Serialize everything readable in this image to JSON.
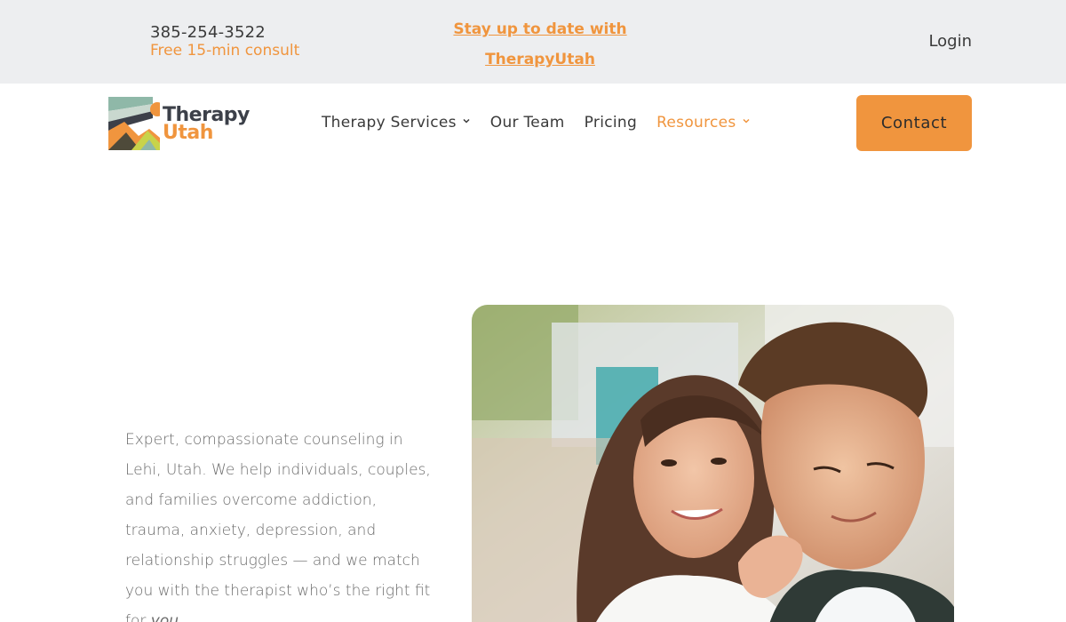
{
  "topbar": {
    "phone": "385-254-3522",
    "consult": "Free 15-min consult",
    "promo_line1": "Stay up to date with",
    "promo_line2": "TherapyUtah",
    "login": "Login"
  },
  "brand": {
    "name_line1": "Therapy",
    "name_line2": "Utah",
    "accent_color": "#f0953e",
    "dark_color": "#3c4049"
  },
  "nav": {
    "items": [
      {
        "label": "Therapy Services",
        "has_dropdown": true,
        "active": false
      },
      {
        "label": "Our Team",
        "has_dropdown": false,
        "active": false
      },
      {
        "label": "Pricing",
        "has_dropdown": false,
        "active": false
      },
      {
        "label": "Resources",
        "has_dropdown": true,
        "active": true
      }
    ],
    "chevron": "⌄",
    "contact": "Contact"
  },
  "hero": {
    "text_main": "Expert, compassionate counseling in Lehi, Utah. We help individuals, couples, and families overcome addiction, trauma, anxiety, depression, and relationship struggles — and we match you with the therapist who’s the right fit for ",
    "text_emphasis": "you",
    "text_end": "."
  }
}
